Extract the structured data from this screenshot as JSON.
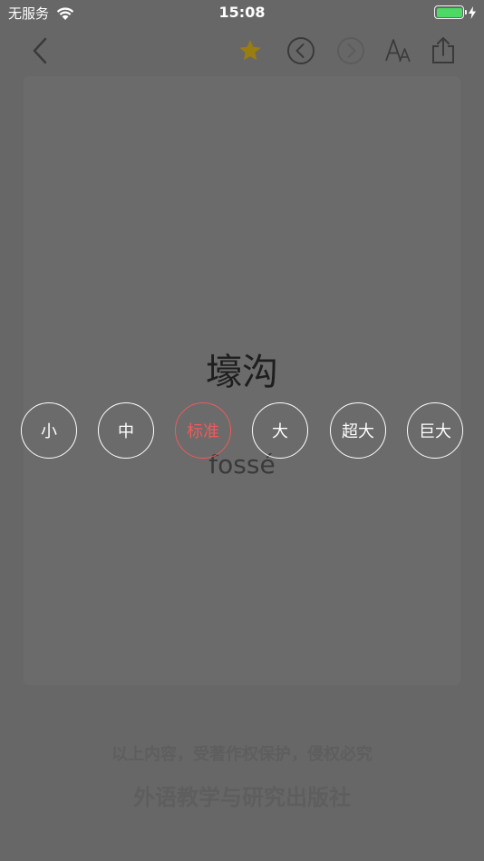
{
  "status_bar": {
    "carrier": "无服务",
    "time": "15:08",
    "battery_color": "#4cd964"
  },
  "nav": {
    "back_icon": "chevron-left-icon",
    "star_icon": "star-icon",
    "star_color": "#9a7d10",
    "prev_icon": "circle-chevron-left-icon",
    "next_icon": "circle-chevron-right-icon",
    "font_icon": "font-size-icon",
    "share_icon": "share-icon"
  },
  "card": {
    "word": "壕沟",
    "translation": "fossé"
  },
  "font_sizes": {
    "options": [
      "小",
      "中",
      "标准",
      "大",
      "超大",
      "巨大"
    ],
    "selected": "标准",
    "selected_color": "#ef5b5b"
  },
  "footer": {
    "copyright": "以上内容，受著作权保护，侵权必究",
    "publisher": "外语教学与研究出版社"
  }
}
